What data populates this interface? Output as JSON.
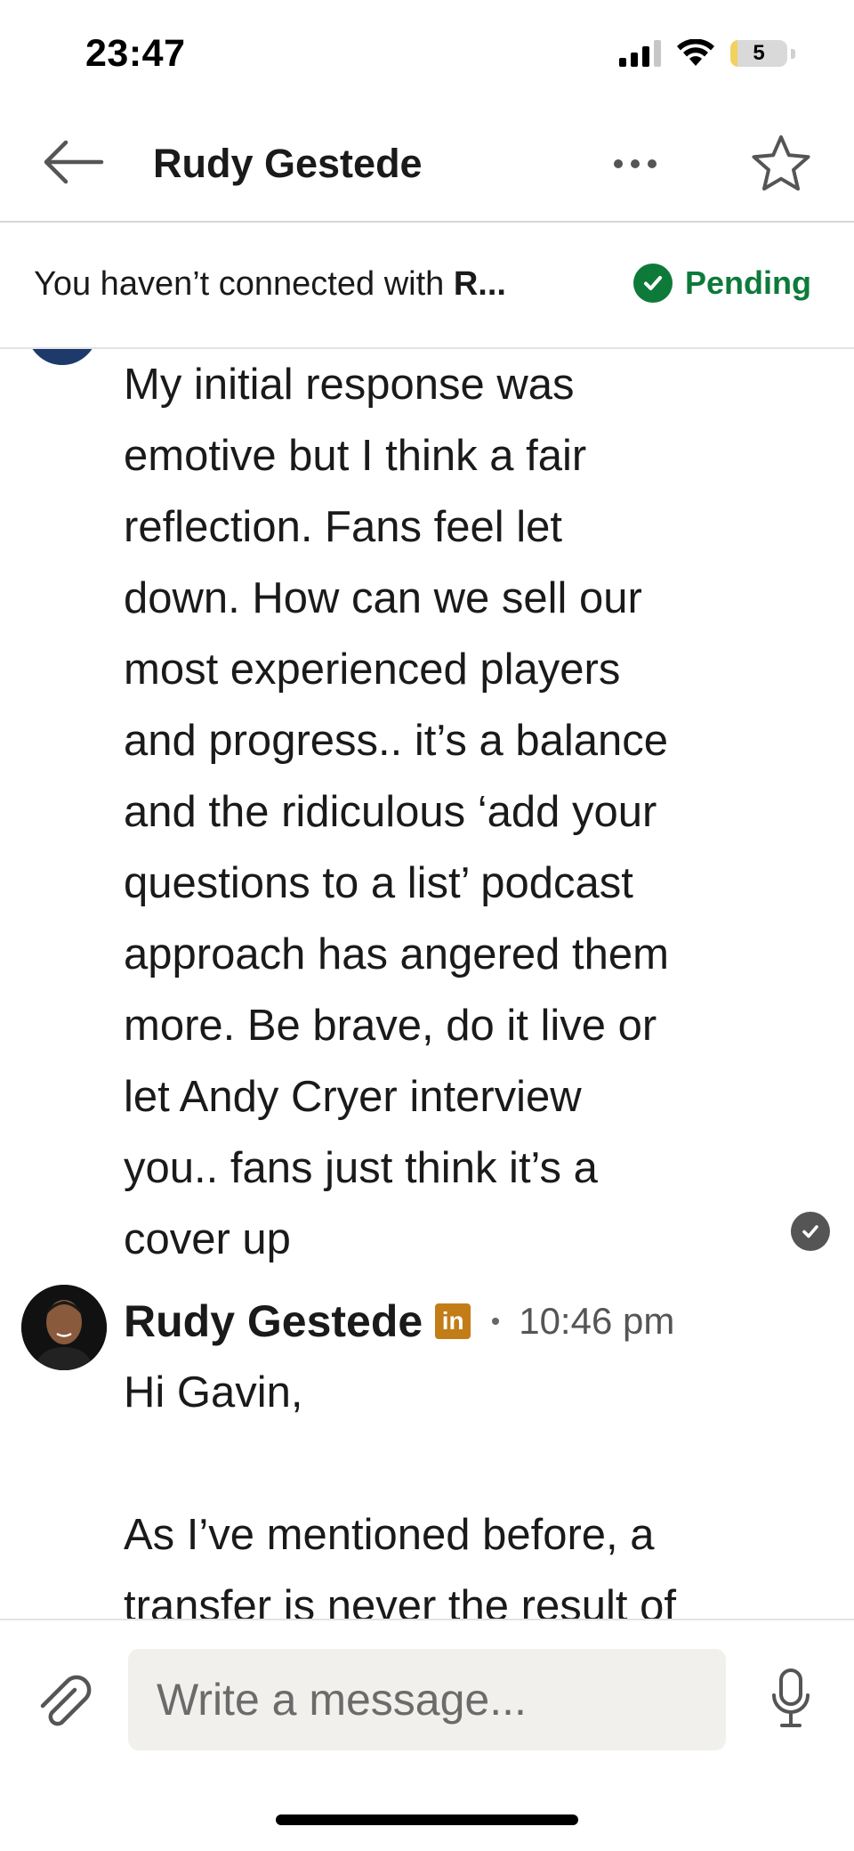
{
  "status_bar": {
    "time": "23:47",
    "battery_level": "5",
    "battery_fraction": 0.05,
    "signal_bars": 3
  },
  "header": {
    "title": "Rudy Gestede",
    "back_icon": "arrow-left-icon",
    "more_icon": "more-horizontal-icon",
    "star_icon": "star-outline-icon"
  },
  "banner": {
    "text": "You haven’t connected with ",
    "name_truncated": "R...",
    "status_label": "Pending",
    "status_color": "#0d7a3a"
  },
  "messages": [
    {
      "body": "My initial response was\nemotive but I think a fair\nreflection. Fans feel let\ndown. How can we sell our\nmost experienced players\nand progress.. it’s a balance\nand the ridiculous ‘add your\nquestions to a list’ podcast\napproach has angered them\nmore. Be brave, do it live or\nlet Andy Cryer interview\nyou.. fans just think it’s a\ncover up",
      "read_icon": "read-receipt-check-icon"
    },
    {
      "sender": "Rudy Gestede",
      "badge": "in",
      "badge_color": "#c37d16",
      "time": "10:46 pm",
      "body": "Hi Gavin,\n\nAs I’ve mentioned before, a\ntransfer is never the result of"
    }
  ],
  "composer": {
    "placeholder": "Write a message...",
    "attach_icon": "paperclip-icon",
    "mic_icon": "microphone-icon"
  }
}
